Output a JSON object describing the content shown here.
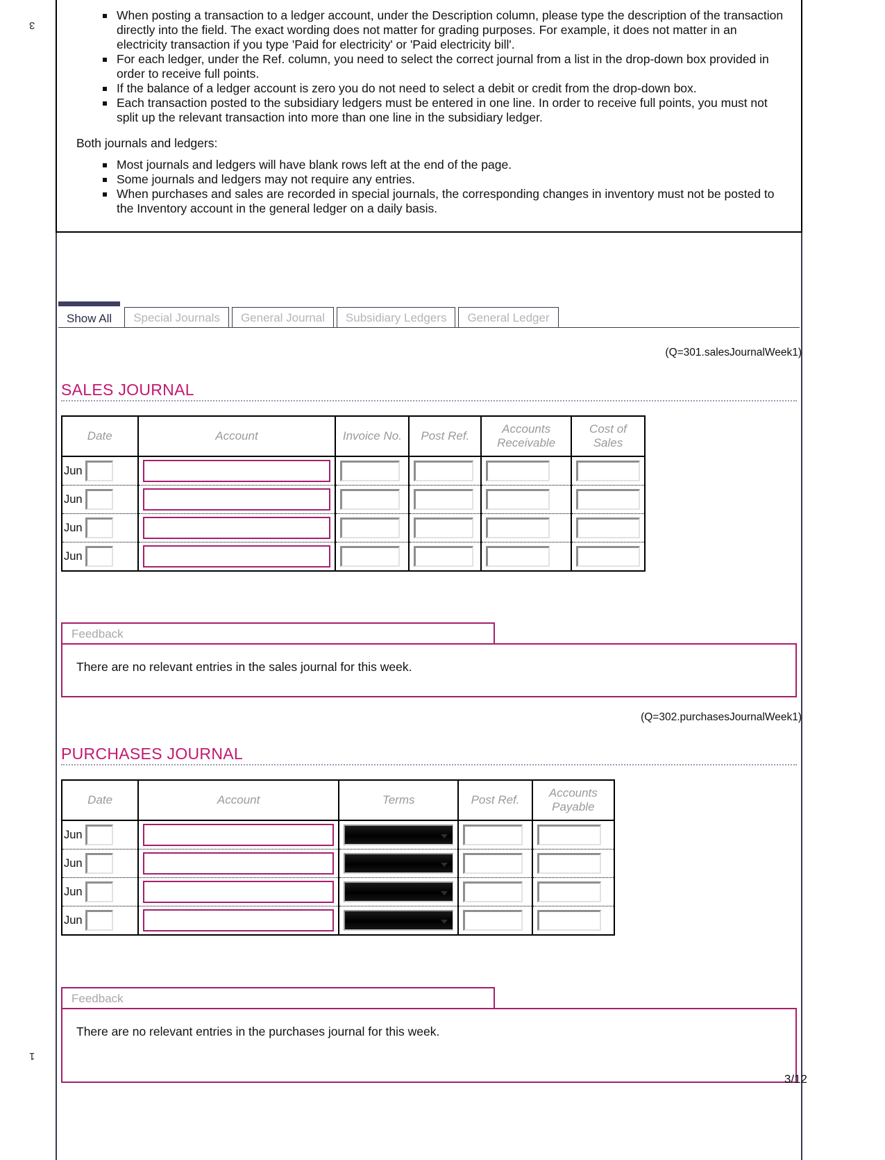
{
  "margin_marks": {
    "top": "3",
    "bottom": "1"
  },
  "page_number": "3/12",
  "instructions": {
    "bullets_top": [
      "When posting a transaction to a ledger account, under the Description column, please type the description of the transaction directly into the field. The exact wording does not matter for grading purposes. For example, it does not matter in an electricity transaction if you type 'Paid for electricity' or 'Paid electricity bill'.",
      "For each ledger, under the Ref. column, you need to select the correct journal from a list in the drop-down box provided in order to receive full points.",
      "If the balance of a ledger account is zero you do not need to select a debit or credit from the drop-down box.",
      "Each transaction posted to the subsidiary ledgers must be entered in one line. In order to receive full points, you must not split up the relevant transaction into more than one line in the subsidiary ledger."
    ],
    "paragraph": "Both journals and ledgers:",
    "bullets_bottom": [
      "Most journals and ledgers will have blank rows left at the end of the page.",
      "Some journals and ledgers may not require any entries.",
      "When purchases and sales are recorded in special journals, the corresponding changes in inventory must not be posted to the Inventory account in the general ledger on a daily basis."
    ]
  },
  "tabs": [
    {
      "label": "Show All",
      "active": true
    },
    {
      "label": "Special Journals",
      "active": false
    },
    {
      "label": "General Journal",
      "active": false
    },
    {
      "label": "Subsidiary Ledgers",
      "active": false
    },
    {
      "label": "General Ledger",
      "active": false
    }
  ],
  "sales_journal": {
    "q_label": "(Q=301.salesJournalWeek1)",
    "title": "SALES JOURNAL",
    "columns": [
      "Date",
      "Account",
      "Invoice No.",
      "Post Ref.",
      "Accounts Receivable",
      "Cost of Sales"
    ],
    "rows": [
      {
        "month": "Jun",
        "day": "",
        "account": "",
        "invoice_no": "",
        "post_ref": "",
        "accounts_receivable": "",
        "cost_of_sales": ""
      },
      {
        "month": "Jun",
        "day": "",
        "account": "",
        "invoice_no": "",
        "post_ref": "",
        "accounts_receivable": "",
        "cost_of_sales": ""
      },
      {
        "month": "Jun",
        "day": "",
        "account": "",
        "invoice_no": "",
        "post_ref": "",
        "accounts_receivable": "",
        "cost_of_sales": ""
      },
      {
        "month": "Jun",
        "day": "",
        "account": "",
        "invoice_no": "",
        "post_ref": "",
        "accounts_receivable": "",
        "cost_of_sales": ""
      }
    ],
    "feedback_label": "Feedback",
    "feedback_text": "There are no relevant entries in the sales journal for this week."
  },
  "purchases_journal": {
    "q_label": "(Q=302.purchasesJournalWeek1)",
    "title": "PURCHASES JOURNAL",
    "columns": [
      "Date",
      "Account",
      "Terms",
      "Post Ref.",
      "Accounts Payable"
    ],
    "rows": [
      {
        "month": "Jun",
        "day": "",
        "account": "",
        "terms": "",
        "post_ref": "",
        "accounts_payable": ""
      },
      {
        "month": "Jun",
        "day": "",
        "account": "",
        "terms": "",
        "post_ref": "",
        "accounts_payable": ""
      },
      {
        "month": "Jun",
        "day": "",
        "account": "",
        "terms": "",
        "post_ref": "",
        "accounts_payable": ""
      },
      {
        "month": "Jun",
        "day": "",
        "account": "",
        "terms": "",
        "post_ref": "",
        "accounts_payable": ""
      }
    ],
    "feedback_label": "Feedback",
    "feedback_text": "There are no relevant entries in the purchases journal for this week."
  },
  "colors": {
    "accent_magenta": "#a61e6e",
    "title_magenta": "#c2186f",
    "tab_navy": "#3f3f63",
    "muted_gray": "#9a9a9a"
  }
}
